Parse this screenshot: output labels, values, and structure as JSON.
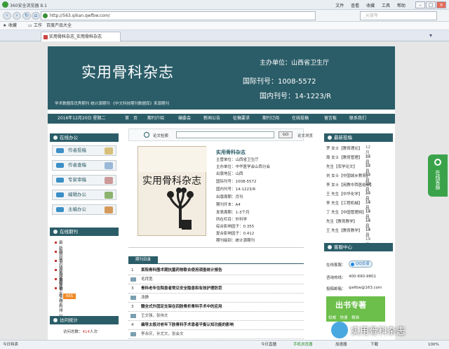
{
  "browser": {
    "title": "360安全浏览器 8.1",
    "menu": [
      "文件",
      "查看",
      "收藏",
      "工具",
      "帮助"
    ],
    "url": "http://563.qikan.qwfbw.com/",
    "search_placeholder": "_元宵年",
    "favorites": [
      "收藏",
      "工作",
      "百度产品大全"
    ],
    "tab_label": "实用骨科杂志_实用骨科杂志"
  },
  "header": {
    "title": "实用骨科杂志",
    "sponsor": "主办单位：山西省卫生厅",
    "issn": "国际刊号：1008-5572",
    "cn": "国内刊号：14-1223/R",
    "slogan": "学术数据库优秀期刊 统计源期刊 《中文科技期刊数据库》来源期刊"
  },
  "navbar": {
    "date": "2016年12月20日 星期二",
    "items": [
      "首　页",
      "期刊介绍",
      "编委会",
      "新闻公告",
      "征稿要求",
      "期刊订阅",
      "在线投稿",
      "留言板",
      "联系我们"
    ]
  },
  "online_office": {
    "heading": "在线办公",
    "buttons": [
      "作者投稿",
      "作者查稿",
      "专家审稿",
      "编辑办公",
      "主编办公"
    ]
  },
  "online_journal": {
    "heading": "在线期刊",
    "items": [
      "最新期刊",
      "期刊浏览目录",
      "本刊论文精选",
      "过刊浏览",
      "论文下载排行",
      "论文点击排行"
    ],
    "rss": "RSS"
  },
  "visit_stats": {
    "heading": "访问统计",
    "label": "访问总数：",
    "count": "414",
    "unit": "人次"
  },
  "search": {
    "label": "论文检索",
    "go": "GO",
    "advanced": "论文浏览"
  },
  "cover": {
    "name": "实用骨科杂志"
  },
  "journal_info": {
    "title": "实用骨科杂志",
    "lines": [
      "主管单位：山西省卫生厅",
      "主办单位：中华医学会山西分会",
      "出版地区：山西",
      "国际刊号：1008-5572",
      "国内刊号：14-1223/R",
      "出版周期：月刊",
      "期刊开本：A4",
      "发表周期：1-3个月",
      "所在栏目：外科学",
      "综合影响因子：0.355",
      "复合影响因子：0.412",
      "期刊级别：统计源期刊"
    ]
  },
  "articles": {
    "tab": "期刊目录",
    "rows": [
      {
        "num": "1",
        "title": "某院骨科围术期抗菌药物联合使用调查统计报告",
        "author": "毛拜宽"
      },
      {
        "num": "3",
        "title": "骨科老年住院患者常见安全隐患和有效护理防范",
        "author": "汤静"
      },
      {
        "num": "3",
        "title": "髓全式外固定支架在四肢骨折骨科手术中的应用",
        "author": "王文强，张伟文"
      },
      {
        "num": "4",
        "title": "编导太极对老年下肢骨科手术患者平衡认知功能的影响",
        "author": "李永庆，孙尤文，张会文"
      }
    ]
  },
  "latest": {
    "heading": "最新投稿",
    "items": [
      {
        "who": "罗 女士【教育理论】",
        "date": "12月20日"
      },
      {
        "who": "周 女士【教育管理】",
        "date": "12月20日"
      },
      {
        "who": "先生【农学论文】",
        "date": "12月20日"
      },
      {
        "who": "刘 女士【中国城乡教育】",
        "date": "12月20日"
      },
      {
        "who": "李 女士【用教中西医结合】",
        "date": "12月20日"
      },
      {
        "who": "王 先生【中华化学】",
        "date": "12月19日"
      },
      {
        "who": "李 先生【工程机械】",
        "date": "12月19日"
      },
      {
        "who": "丁 先生【中国管理网】",
        "date": "12月19日"
      },
      {
        "who": "先生【教育教学】",
        "date": "12月19日"
      },
      {
        "who": "王 先生【教育教学】",
        "date": "12月19日"
      }
    ]
  },
  "customer": {
    "heading": "客服中心",
    "online_label": "在线客服：",
    "qq": "QQ交谈",
    "hotline_label": "咨询热线：",
    "hotline": "400-690-9801",
    "email_label": "投稿邮箱：",
    "email": "qwfbw@163.com"
  },
  "book_banner": {
    "title": "出书专著",
    "tags": [
      "权威",
      "快速",
      "精准"
    ]
  },
  "float_tab": "在线客服",
  "watermark": "实用骨科杂志",
  "statusbar": {
    "left": "今日特卖",
    "items": [
      "今日直播",
      "手机浏览器",
      "加速器",
      "下载",
      "100%"
    ]
  }
}
